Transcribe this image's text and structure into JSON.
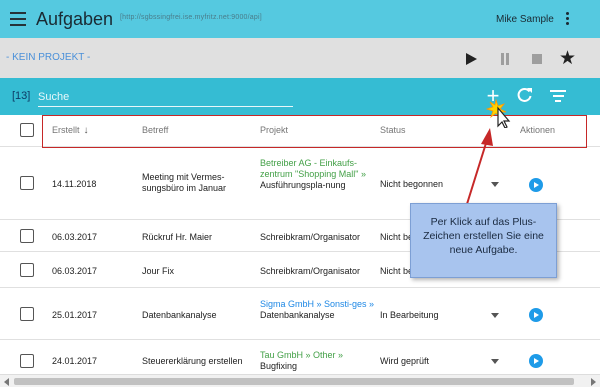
{
  "app": {
    "title": "Aufgaben",
    "url": "[http://sgbssingfrei.ise.myfritz.net:9000/api]",
    "user": "Mike Sample"
  },
  "project_bar": {
    "label": "- KEIN PROJEKT -"
  },
  "search": {
    "count": "[13]",
    "placeholder": "Suche",
    "value": ""
  },
  "table": {
    "headers": {
      "created": "Erstellt",
      "subject": "Betreff",
      "project": "Projekt",
      "status": "Status",
      "actions": "Aktionen"
    },
    "rows": [
      {
        "date": "14.11.2018",
        "subject": "Meeting mit Vermes-sungsbüro im Januar",
        "project_link": "Betreiber AG - Einkaufs-zentrum \"Shopping Mall\" »",
        "project_text": "Ausführungspla-nung",
        "status": "Nicht begonnen"
      },
      {
        "date": "06.03.2017",
        "subject": "Rückruf Hr. Maier",
        "project_link": "",
        "project_text": "Schreibkram/Organisator",
        "status": "Nicht be"
      },
      {
        "date": "06.03.2017",
        "subject": "Jour Fix",
        "project_link": "",
        "project_text": "Schreibkram/Organisator",
        "status": "Nicht be"
      },
      {
        "date": "25.01.2017",
        "subject": "Datenbankanalyse",
        "project_link": "Sigma GmbH » Sonsti-ges »",
        "project_text": "Datenbankanalyse",
        "status": "In Bearbeitung"
      },
      {
        "date": "24.01.2017",
        "subject": "Steuererklärung erstellen",
        "project_link": "Tau GmbH » Other »",
        "project_text": "Bugfixing",
        "status": "Wird geprüft"
      }
    ]
  },
  "annotation": {
    "text": "Per Klick auf das Plus-Zeichen erstellen Sie eine neue Aufgabe."
  },
  "colors": {
    "appbar": "#55c9e0",
    "searchbar": "#35bcd3",
    "highlight": "#c62828",
    "callout": "#a8c4ee",
    "action_button": "#1e9be8"
  },
  "icons": [
    "menu-icon",
    "kebab-menu-icon",
    "play-icon",
    "pause-icon",
    "stop-icon",
    "star-icon",
    "plus-icon",
    "refresh-icon",
    "filter-icon",
    "sort-arrow-icon",
    "dropdown-caret-icon",
    "play-button-icon",
    "cursor-icon"
  ]
}
